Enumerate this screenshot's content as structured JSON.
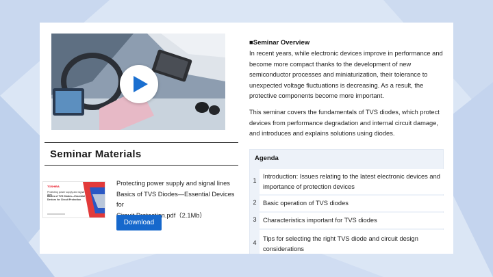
{
  "video": {
    "play_icon": "play-icon",
    "thumbnail_description": "car-interior-with-devices"
  },
  "materials": {
    "title": "Seminar Materials",
    "thumb": {
      "brand": "TOSHIBA",
      "line1": "Protecting power supply and signal lines",
      "line2": "Basics of TVS Diodes—Essential",
      "line3": "Devices for Circuit Protection"
    },
    "document": {
      "line1": "Protecting power supply and signal lines",
      "line2": "Basics of TVS Diodes—Essential Devices for",
      "line3": "Circuit Protection.pdf（2.1Mb）"
    },
    "download_label": "Download"
  },
  "overview": {
    "title": "■Seminar Overview",
    "p1_lines": [
      "In recent years, while electronic devices improve in performance and",
      "become more compact thanks to the development of new",
      "semiconductor processes and miniaturization, their tolerance to",
      "unexpected voltage fluctuations is decreasing. As a result, the",
      "protective components become more important."
    ],
    "p2_lines": [
      "This seminar covers the fundamentals of TVS diodes, which protect",
      "devices from performance degradation and internal circuit damage,",
      "and introduces and explains solutions using diodes."
    ]
  },
  "agenda": {
    "title": "Agenda",
    "items": [
      {
        "num": "1",
        "lines": [
          "Introduction: Issues relating to the latest electronic devices and",
          "importance of protection devices"
        ]
      },
      {
        "num": "2",
        "lines": [
          "Basic operation of TVS diodes"
        ]
      },
      {
        "num": "3",
        "lines": [
          "Characteristics important for TVS diodes"
        ]
      },
      {
        "num": "4",
        "lines": [
          "Tips for selecting the right TVS diode and circuit design",
          "considerations"
        ]
      }
    ]
  },
  "colors": {
    "accent": "#1668cc",
    "background": "#dbe6f5",
    "agenda_bg": "#edf2f9",
    "brand_red": "#e60012"
  }
}
